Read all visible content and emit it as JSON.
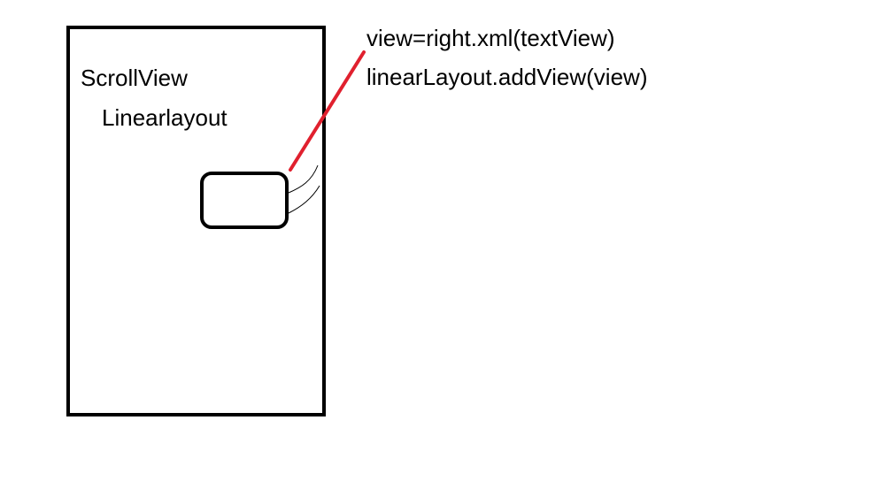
{
  "diagram": {
    "labels": {
      "scrollview": "ScrollView",
      "linearlayout": "Linearlayout"
    },
    "code_lines": [
      "view=right.xml(textView)",
      "linearLayout.addView(view)"
    ],
    "colors": {
      "stroke": "#000000",
      "arrow": "#e0202e",
      "background": "#ffffff"
    }
  }
}
